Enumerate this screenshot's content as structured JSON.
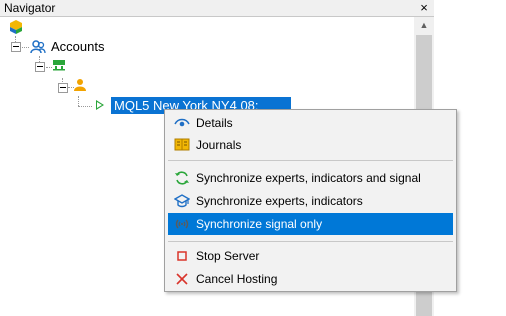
{
  "window": {
    "title": "Navigator",
    "close_glyph": "×"
  },
  "scrollbar": {
    "up_arrow": "▲"
  },
  "tree": {
    "root_icon": "mql5-logo-icon",
    "accounts_label": "Accounts",
    "server_node_icon": "server-icon",
    "user_node_icon": "user-icon",
    "selected_account_label": "MQL5 New York NY4 08:"
  },
  "context_menu": {
    "items": [
      {
        "label": "Details",
        "icon": "eye-icon"
      },
      {
        "label": "Journals",
        "icon": "journal-icon"
      },
      {
        "label": "Synchronize experts, indicators and signal",
        "icon": "sync-icon"
      },
      {
        "label": "Synchronize experts, indicators",
        "icon": "graduation-cap-icon"
      },
      {
        "label": "Synchronize signal only",
        "icon": "signal-icon",
        "highlighted": true
      },
      {
        "label": "Stop Server",
        "icon": "stop-icon"
      },
      {
        "label": "Cancel Hosting",
        "icon": "cancel-icon"
      }
    ]
  },
  "colors": {
    "selection": "#0078d7",
    "tree_selection": "#0a73d3",
    "stop": "#d9342b",
    "sync_green": "#2aa63a",
    "accent_blue": "#1f6fc5"
  }
}
